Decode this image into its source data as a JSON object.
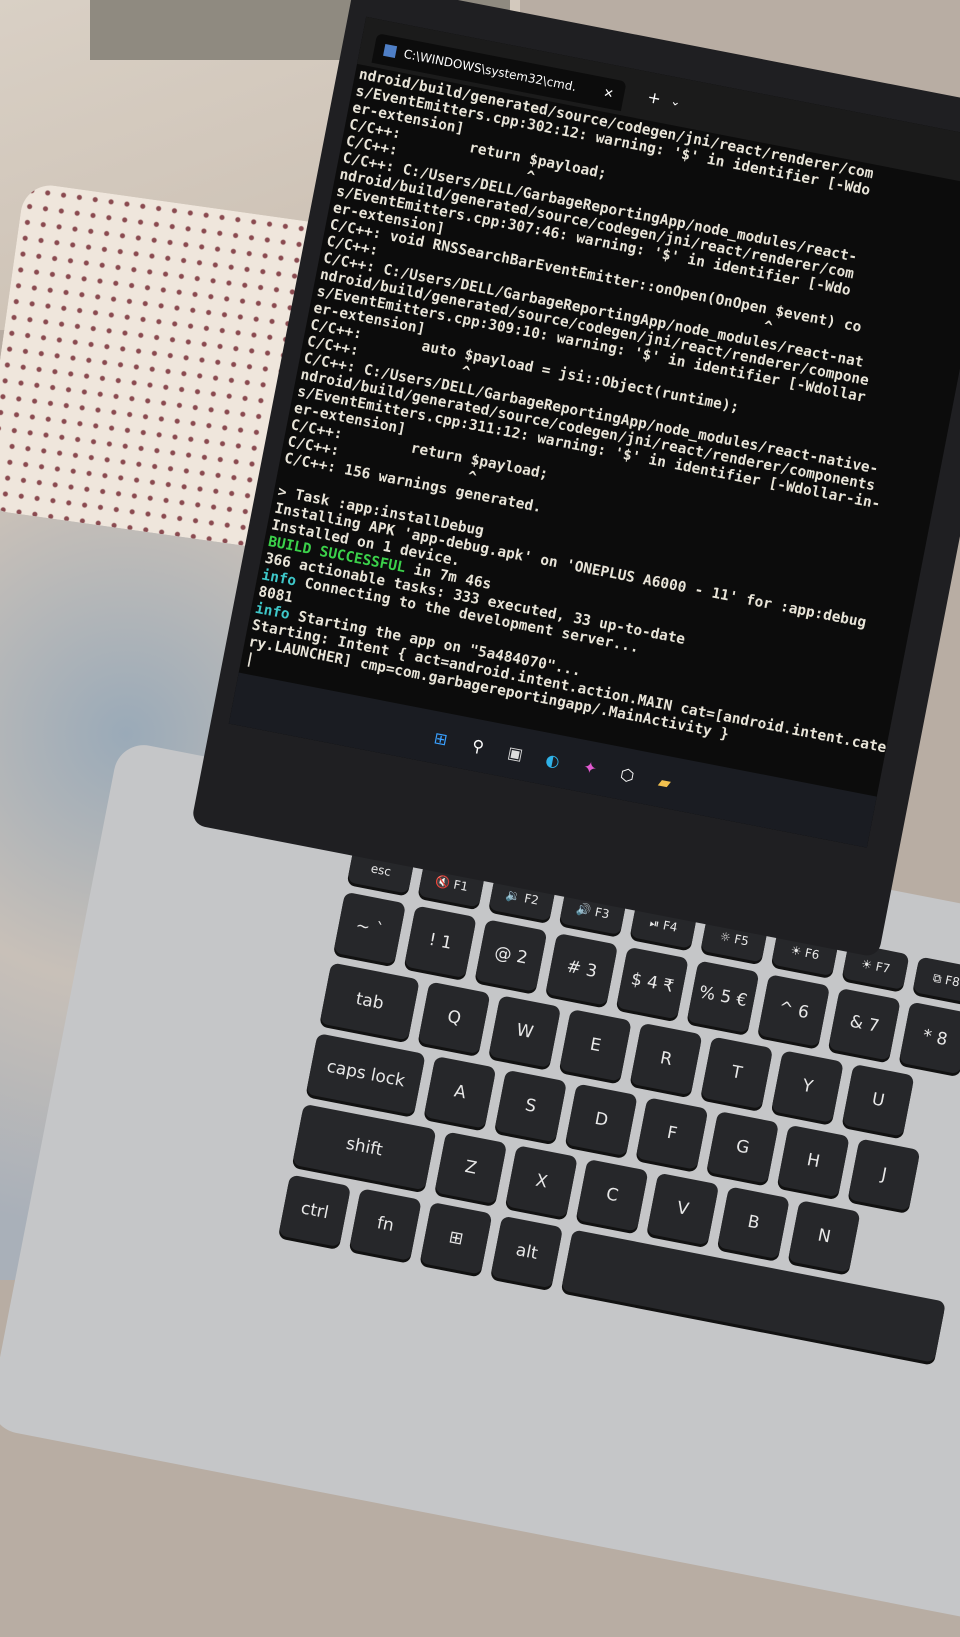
{
  "window": {
    "title": "C:\\WINDOWS\\system32\\cmd.",
    "close": "✕",
    "new_tab": "+",
    "dropdown": "⌄"
  },
  "terminal": {
    "lines": [
      {
        "text": "ndroid/build/generated/source/codegen/jni/react/renderer/com"
      },
      {
        "text": "s/EventEmitters.cpp:302:12: warning: '$' in identifier [-Wdo"
      },
      {
        "text": "er-extension]"
      },
      {
        "text": "C/C++:        return $payload;"
      },
      {
        "text": "C/C++:               ^"
      },
      {
        "text": "C/C++: C:/Users/DELL/GarbageReportingApp/node_modules/react-"
      },
      {
        "text": "ndroid/build/generated/source/codegen/jni/react/renderer/com"
      },
      {
        "text": "s/EventEmitters.cpp:307:46: warning: '$' in identifier [-Wdo"
      },
      {
        "text": "er-extension]"
      },
      {
        "text": "C/C++: void RNSSearchBarEventEmitter::onOpen(OnOpen $event) co"
      },
      {
        "text": "C/C++:                                             ^"
      },
      {
        "text": "C/C++: C:/Users/DELL/GarbageReportingApp/node_modules/react-nat"
      },
      {
        "text": "ndroid/build/generated/source/codegen/jni/react/renderer/compone"
      },
      {
        "text": "s/EventEmitters.cpp:309:10: warning: '$' in identifier [-Wdollar"
      },
      {
        "text": "er-extension]"
      },
      {
        "text": "C/C++:       auto $payload = jsi::Object(runtime);"
      },
      {
        "text": "C/C++:            ^"
      },
      {
        "text": "C/C++: C:/Users/DELL/GarbageReportingApp/node_modules/react-native-"
      },
      {
        "text": "ndroid/build/generated/source/codegen/jni/react/renderer/components"
      },
      {
        "text": "s/EventEmitters.cpp:311:12: warning: '$' in identifier [-Wdollar-in-"
      },
      {
        "text": "er-extension]"
      },
      {
        "text": "C/C++:        return $payload;"
      },
      {
        "text": "C/C++:               ^"
      },
      {
        "text": "C/C++: 156 warnings generated."
      },
      {
        "text": " "
      },
      {
        "text": "> Task :app:installDebug"
      },
      {
        "text": "Installing APK 'app-debug.apk' on 'ONEPLUS A6000 - 11' for :app:debug"
      },
      {
        "text": "Installed on 1 device."
      },
      {
        "tag": "BUILD SUCCESSFUL",
        "tag_color": "green",
        "text": " in 7m 46s"
      },
      {
        "text": "366 actionable tasks: 333 executed, 33 up-to-date"
      },
      {
        "tag": "info",
        "tag_color": "cyan",
        "text": " Connecting to the development server..."
      },
      {
        "text": "8081"
      },
      {
        "tag": "info",
        "tag_color": "cyan",
        "text": " Starting the app on \"5a484070\"..."
      },
      {
        "text": "Starting: Intent { act=android.intent.action.MAIN cat=[android.intent.catego"
      },
      {
        "text": "ry.LAUNCHER] cmp=com.garbagereportingapp/.MainActivity }"
      },
      {
        "text": "|"
      }
    ]
  },
  "taskbar": [
    {
      "name": "start-icon",
      "glyph": "⊞",
      "color": "#3aa0ff"
    },
    {
      "name": "search-icon",
      "glyph": "⚲",
      "color": "#ffffff"
    },
    {
      "name": "task-view-icon",
      "glyph": "▣",
      "color": "#dddddd"
    },
    {
      "name": "edge-icon",
      "glyph": "◐",
      "color": "#2fb2e8"
    },
    {
      "name": "copilot-icon",
      "glyph": "✦",
      "color": "#e05ad0"
    },
    {
      "name": "app-icon",
      "glyph": "⬡",
      "color": "#ffffff"
    },
    {
      "name": "file-explorer-icon",
      "glyph": "▰",
      "color": "#f2c14e"
    }
  ],
  "keyboard": {
    "rows": [
      [
        {
          "l": "esc",
          "c": "f"
        },
        {
          "l": "🔇 F1",
          "c": "f"
        },
        {
          "l": "🔉 F2",
          "c": "f"
        },
        {
          "l": "🔊 F3",
          "c": "f"
        },
        {
          "l": "⏯ F4",
          "c": "f"
        },
        {
          "l": "☼ F5",
          "c": "f"
        },
        {
          "l": "☀ F6",
          "c": "f"
        },
        {
          "l": "☀ F7",
          "c": "f"
        },
        {
          "l": "⧉ F8",
          "c": "f"
        }
      ],
      [
        {
          "l": "~ `"
        },
        {
          "l": "! 1"
        },
        {
          "l": "@ 2"
        },
        {
          "l": "# 3"
        },
        {
          "l": "$ 4 ₹"
        },
        {
          "l": "% 5 €"
        },
        {
          "l": "^ 6"
        },
        {
          "l": "& 7"
        },
        {
          "l": "* 8"
        }
      ],
      [
        {
          "l": "tab",
          "c": "wide1"
        },
        {
          "l": "Q"
        },
        {
          "l": "W"
        },
        {
          "l": "E"
        },
        {
          "l": "R"
        },
        {
          "l": "T"
        },
        {
          "l": "Y"
        },
        {
          "l": "U"
        }
      ],
      [
        {
          "l": "caps lock",
          "c": "wide2"
        },
        {
          "l": "A"
        },
        {
          "l": "S"
        },
        {
          "l": "D"
        },
        {
          "l": "F"
        },
        {
          "l": "G"
        },
        {
          "l": "H"
        },
        {
          "l": "J"
        }
      ],
      [
        {
          "l": "shift",
          "c": "wide3"
        },
        {
          "l": "Z"
        },
        {
          "l": "X"
        },
        {
          "l": "C"
        },
        {
          "l": "V"
        },
        {
          "l": "B"
        },
        {
          "l": "N"
        }
      ],
      [
        {
          "l": "ctrl"
        },
        {
          "l": "fn"
        },
        {
          "l": "⊞"
        },
        {
          "l": "alt"
        },
        {
          "l": " ",
          "c": "space"
        }
      ]
    ]
  }
}
